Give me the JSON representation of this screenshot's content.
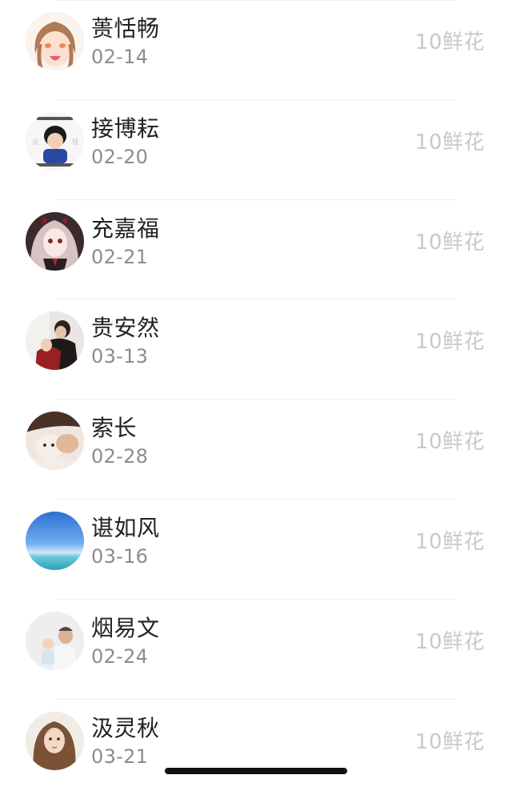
{
  "list": {
    "items": [
      {
        "name": "蒉恬畅",
        "date": "02-14",
        "reward": "10鲜花",
        "avatar": "anime-girl-avatar"
      },
      {
        "name": "接博耘",
        "date": "02-20",
        "reward": "10鲜花",
        "avatar": "meme-boy-avatar"
      },
      {
        "name": "充嘉福",
        "date": "02-21",
        "reward": "10鲜花",
        "avatar": "anime-twintail-avatar"
      },
      {
        "name": "贵安然",
        "date": "03-13",
        "reward": "10鲜花",
        "avatar": "couple-photo-avatar"
      },
      {
        "name": "索长",
        "date": "02-28",
        "reward": "10鲜花",
        "avatar": "cat-photo-avatar"
      },
      {
        "name": "谌如风",
        "date": "03-16",
        "reward": "10鲜花",
        "avatar": "sea-sky-avatar"
      },
      {
        "name": "烟易文",
        "date": "02-24",
        "reward": "10鲜花",
        "avatar": "father-child-avatar"
      },
      {
        "name": "汲灵秋",
        "date": "03-21",
        "reward": "10鲜花",
        "avatar": "woman-portrait-avatar"
      }
    ]
  }
}
